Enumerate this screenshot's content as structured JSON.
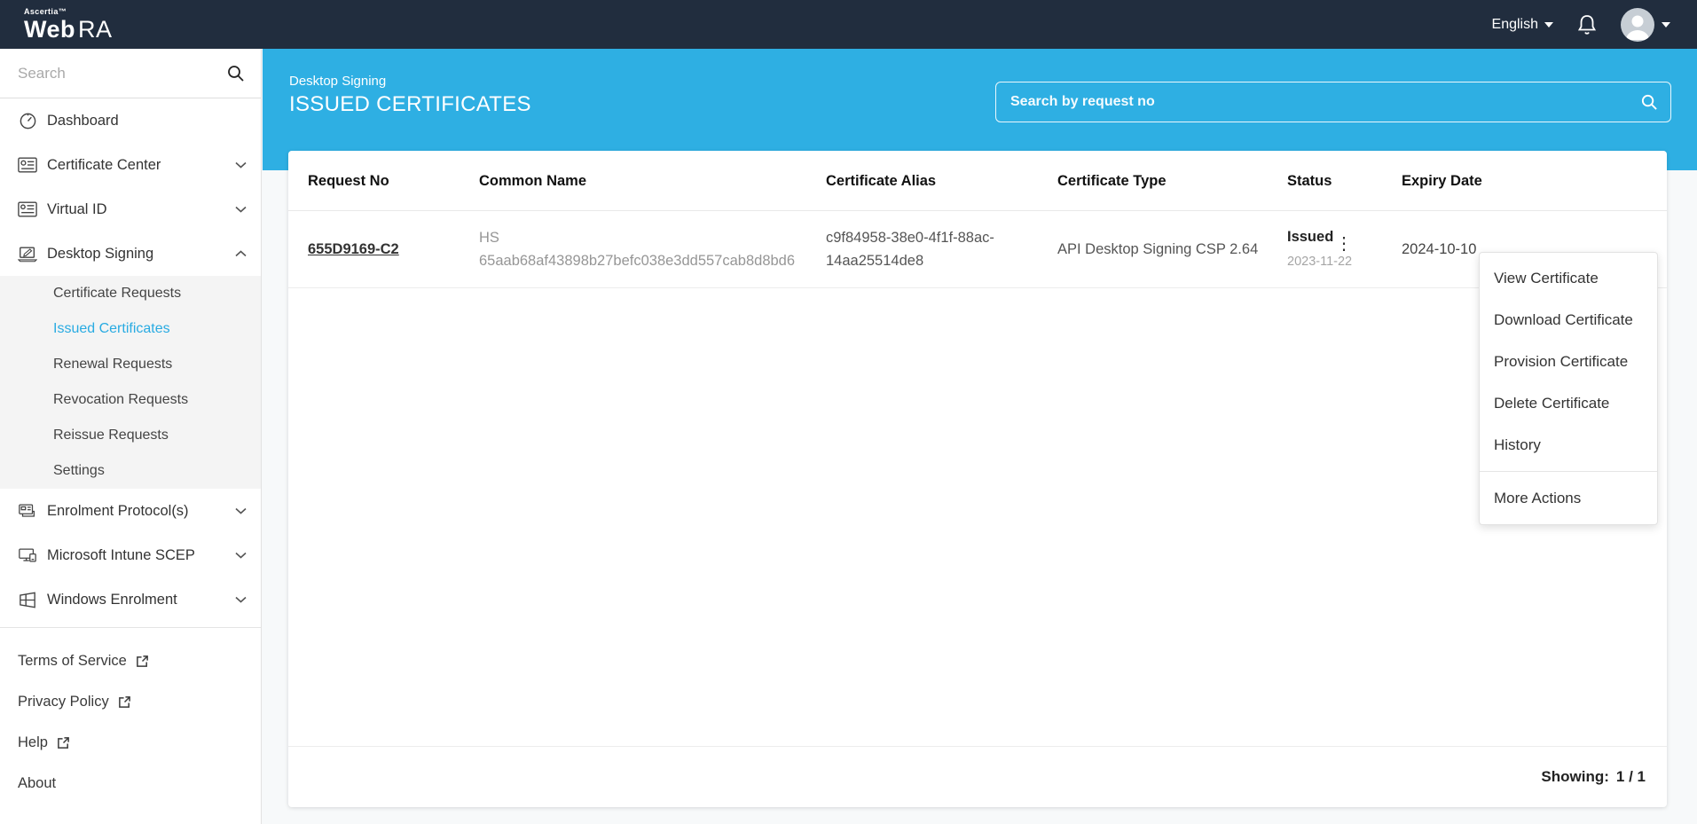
{
  "brand": {
    "company": "Ascertia™",
    "product_bold": "Web",
    "product_light": "RA"
  },
  "topbar": {
    "language": "English"
  },
  "sidebar": {
    "search_placeholder": "Search",
    "items": [
      {
        "label": "Dashboard"
      },
      {
        "label": "Certificate Center"
      },
      {
        "label": "Virtual ID"
      },
      {
        "label": "Desktop Signing"
      },
      {
        "label": "Enrolment Protocol(s)"
      },
      {
        "label": "Microsoft Intune SCEP"
      },
      {
        "label": "Windows Enrolment"
      }
    ],
    "desktop_signing_submenu": [
      {
        "label": "Certificate Requests",
        "active": false
      },
      {
        "label": "Issued Certificates",
        "active": true
      },
      {
        "label": "Renewal Requests",
        "active": false
      },
      {
        "label": "Revocation Requests",
        "active": false
      },
      {
        "label": "Reissue Requests",
        "active": false
      },
      {
        "label": "Settings",
        "active": false
      }
    ],
    "footer_links": [
      {
        "label": "Terms of Service",
        "external": true
      },
      {
        "label": "Privacy Policy",
        "external": true
      },
      {
        "label": "Help",
        "external": true
      },
      {
        "label": "About",
        "external": false
      }
    ]
  },
  "page_header": {
    "breadcrumb": "Desktop Signing",
    "title": "ISSUED CERTIFICATES",
    "search_placeholder": "Search by request no"
  },
  "table": {
    "columns": [
      "Request No",
      "Common Name",
      "Certificate Alias",
      "Certificate Type",
      "Status",
      "Expiry Date"
    ],
    "rows": [
      {
        "request_no": "655D9169-C2",
        "common_name": "HS 65aab68af43898b27befc038e3dd557cab8d8bd6",
        "certificate_alias": "c9f84958-38e0-4f1f-88ac-14aa25514de8",
        "certificate_type": "API Desktop Signing CSP 2.64",
        "status": "Issued",
        "status_date": "2023-11-22",
        "expiry_date": "2024-10-10"
      }
    ]
  },
  "context_menu": {
    "items": [
      "View Certificate",
      "Download Certificate",
      "Provision Certificate",
      "Delete Certificate",
      "History"
    ],
    "footer_item": "More Actions"
  },
  "pagination": {
    "label": "Showing:",
    "value": "1 / 1"
  },
  "colors": {
    "accent": "#2eafe3",
    "topbar": "#212d3e",
    "active_link": "#29abe2"
  }
}
